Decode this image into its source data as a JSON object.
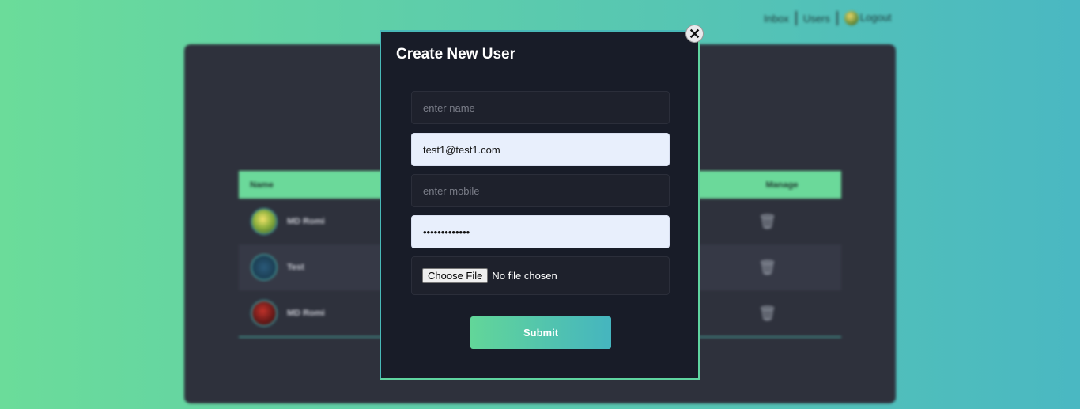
{
  "nav": {
    "inbox": "Inbox",
    "users": "Users",
    "logout": "Logout"
  },
  "table": {
    "headers": {
      "name": "Name",
      "manage": "Manage"
    },
    "rows": [
      {
        "name": "MD Romi",
        "avatar": "avatar-icon"
      },
      {
        "name": "Test",
        "avatar": "avatar-icon"
      },
      {
        "name": "MD Romi",
        "avatar": "avatar-icon"
      }
    ]
  },
  "modal": {
    "title": "Create New User",
    "close_symbol": "✕",
    "name_placeholder": "enter name",
    "name_value": "",
    "email_value": "test1@test1.com",
    "mobile_placeholder": "enter mobile",
    "mobile_value": "",
    "password_value": "•••••••••••••",
    "file_button": "Choose File",
    "file_status": "No file chosen",
    "submit": "Submit"
  },
  "colors": {
    "gradient_start": "#6bdc9a",
    "gradient_end": "#4ab8c2",
    "modal_bg": "#181c28",
    "panel_bg": "#2e313c"
  },
  "icons": [
    "close-icon",
    "trash-icon",
    "avatar-icon"
  ]
}
